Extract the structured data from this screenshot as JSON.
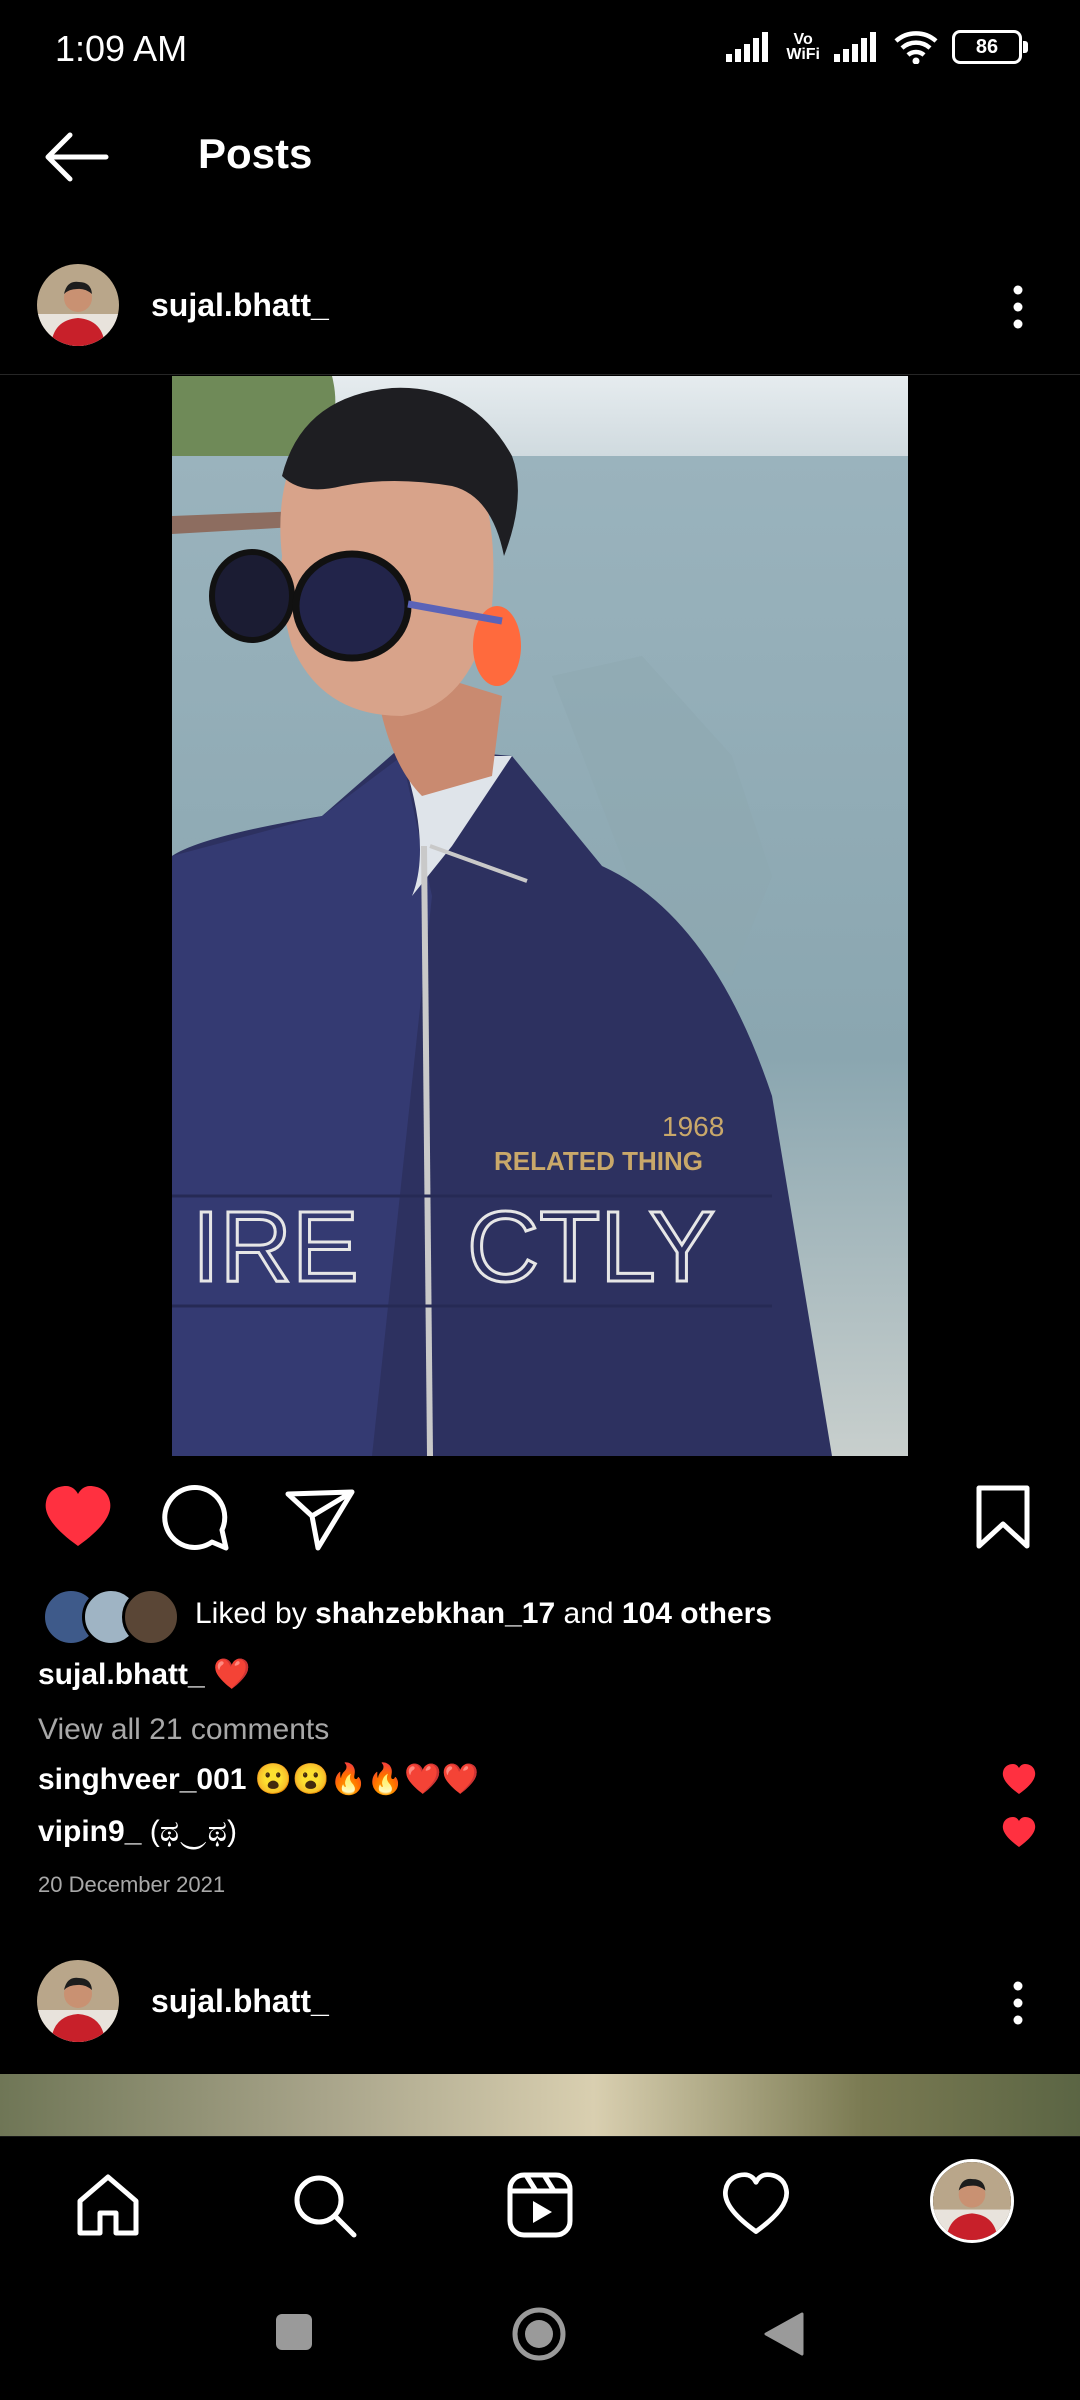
{
  "status_bar": {
    "time": "1:09 AM",
    "vowifi_line1": "Vo",
    "vowifi_line2": "WiFi",
    "battery": "86"
  },
  "header": {
    "title": "Posts"
  },
  "post": {
    "username": "sujal.bhatt_",
    "photo_text": {
      "year": "1968",
      "brand": "RELATED THING",
      "jacket_left": "IRE",
      "jacket_right": "CTLY"
    },
    "liked_by_prefix": "Liked by ",
    "liked_by_user": "shahzebkhan_17",
    "liked_by_and": " and ",
    "liked_by_others": "104 others",
    "caption_user": "sujal.bhatt_",
    "caption_text": "❤️",
    "view_comments": "View all 21 comments",
    "comments": [
      {
        "user": "singhveer_001",
        "text": "😮😮🔥🔥❤️❤️"
      },
      {
        "user": "vipin9_",
        "text": "(ಥ‿ಥ)"
      }
    ],
    "date": "20 December 2021"
  },
  "next_post": {
    "username": "sujal.bhatt_"
  },
  "colors": {
    "like_red": "#ff3040",
    "background": "#000000",
    "secondary_text": "#a8a8a8"
  }
}
